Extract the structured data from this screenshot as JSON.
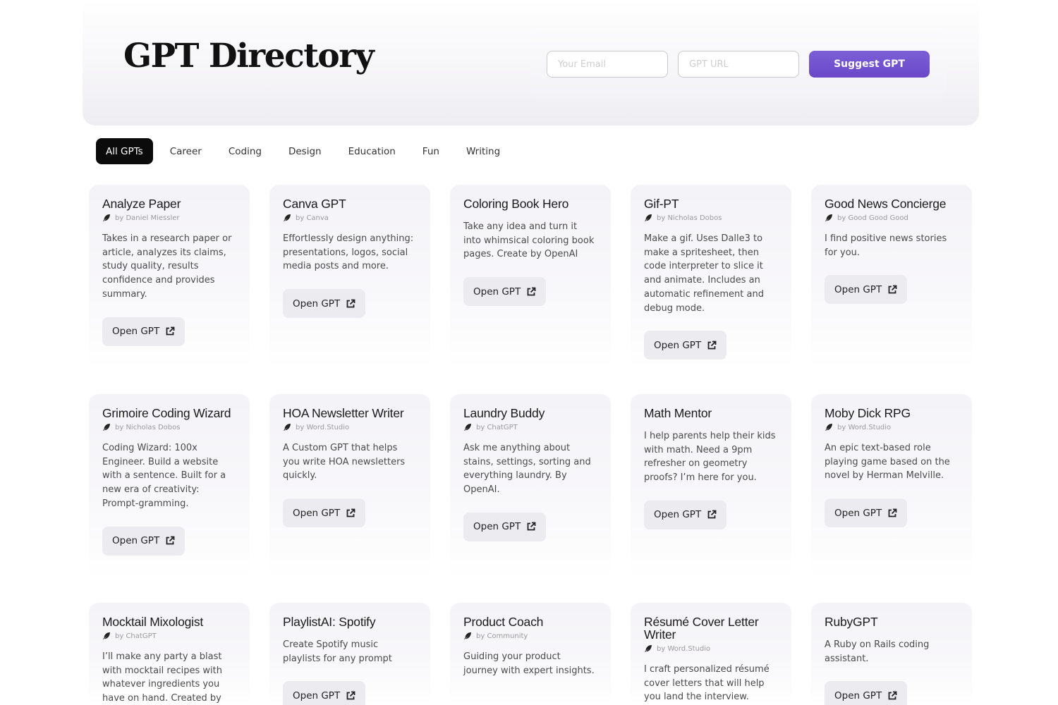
{
  "header": {
    "title": "GPT Directory",
    "email_placeholder": "Your Email",
    "url_placeholder": "GPT URL",
    "suggest_label": "Suggest GPT",
    "accent_color": "#6a48c9"
  },
  "tabs": [
    {
      "label": "All GPTs",
      "active": true
    },
    {
      "label": "Career",
      "active": false
    },
    {
      "label": "Coding",
      "active": false
    },
    {
      "label": "Design",
      "active": false
    },
    {
      "label": "Education",
      "active": false
    },
    {
      "label": "Fun",
      "active": false
    },
    {
      "label": "Writing",
      "active": false
    }
  ],
  "open_label": "Open GPT",
  "cards": [
    {
      "title": "Analyze Paper",
      "author": "by Daniel Miessler",
      "desc": "Takes in a research paper or article, analyzes its claims, study quality, results confidence and provides summary."
    },
    {
      "title": "Canva GPT",
      "author": "by Canva",
      "desc": "Effortlessly design anything: presentations, logos, social media posts and more."
    },
    {
      "title": "Coloring Book Hero",
      "author": "",
      "desc": "Take any idea and turn it into whimsical coloring book pages. Create by OpenAI"
    },
    {
      "title": "Gif-PT",
      "author": "by Nicholas Dobos",
      "desc": "Make a gif. Uses Dalle3 to make a spritesheet, then code interpreter to slice it and animate. Includes an automatic refinement and debug mode."
    },
    {
      "title": "Good News Concierge",
      "author": "by Good Good Good",
      "desc": "I find positive news stories for you."
    },
    {
      "title": "Grimoire Coding Wizard",
      "author": "by Nicholas Dobos",
      "desc": "Coding Wizard: 100x Engineer. Build a website with a sentence. Built for a new era of creativity: Prompt-gramming."
    },
    {
      "title": "HOA Newsletter Writer",
      "author": "by Word.Studio",
      "desc": "A Custom GPT that helps you write HOA newsletters quickly."
    },
    {
      "title": "Laundry Buddy",
      "author": "by ChatGPT",
      "desc": "Ask me anything about stains, settings, sorting and everything laundry. By OpenAI."
    },
    {
      "title": "Math Mentor",
      "author": "",
      "desc": "I help parents help their kids with math. Need a 9pm refresher on geometry proofs? I’m here for you."
    },
    {
      "title": "Moby Dick RPG",
      "author": "by Word.Studio",
      "desc": "An epic text-based role playing game based on the novel by Herman Melville."
    },
    {
      "title": "Mocktail Mixologist",
      "author": "by ChatGPT",
      "desc": "I’ll make any party a blast with mocktail recipes with whatever ingredients you have on hand. Created by OpenAI."
    },
    {
      "title": "PlaylistAI: Spotify",
      "author": "",
      "desc": "Create Spotify music playlists for any prompt"
    },
    {
      "title": "Product Coach",
      "author": "by Community",
      "desc": "Guiding your product journey with expert insights."
    },
    {
      "title": "Résumé Cover Letter Writer",
      "author": "by Word.Studio",
      "desc": "I craft personalized résumé cover letters that will help you land the interview."
    },
    {
      "title": "RubyGPT",
      "author": "",
      "desc": "A Ruby on Rails coding assistant."
    }
  ]
}
